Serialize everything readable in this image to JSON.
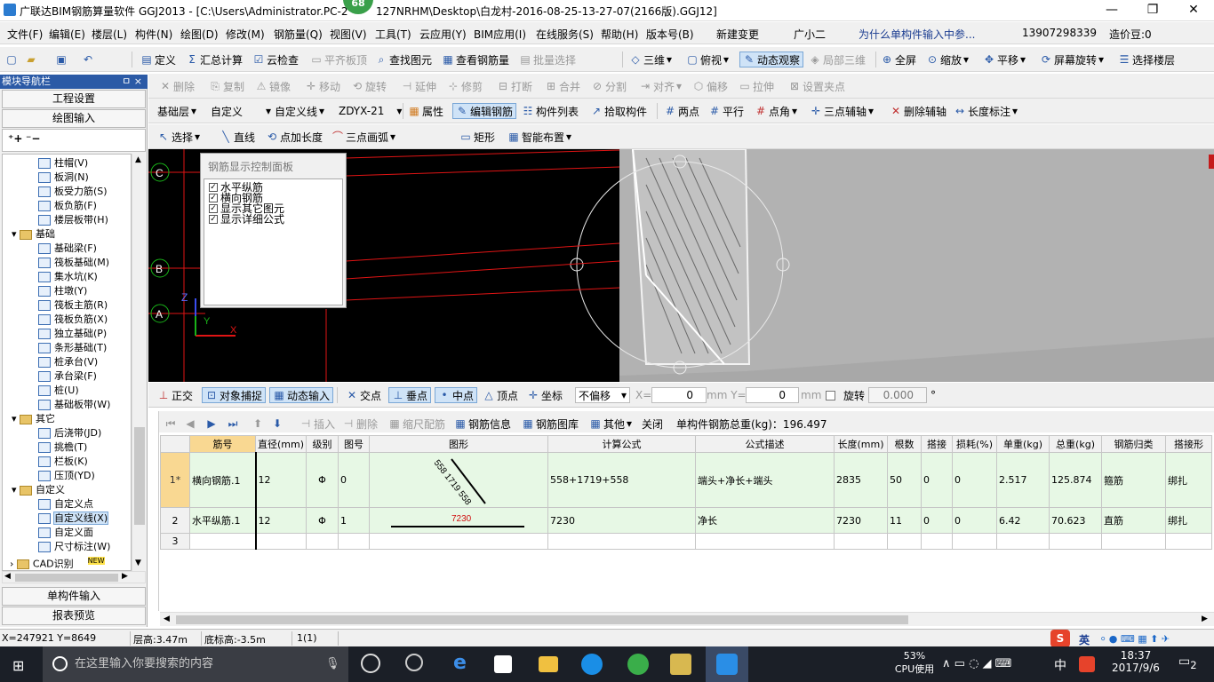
{
  "window": {
    "title": "广联达BIM钢筋算量软件 GGJ2013 - [C:\\Users\\Administrator.PC-2",
    "title_tail": "127NRHM\\Desktop\\白龙村-2016-08-25-13-27-07(2166版).GGJ12]",
    "badge": "68"
  },
  "menu": [
    "文件(F)",
    "编辑(E)",
    "楼层(L)",
    "构件(N)",
    "绘图(D)",
    "修改(M)",
    "钢筋量(Q)",
    "视图(V)",
    "工具(T)",
    "云应用(Y)",
    "BIM应用(I)",
    "在线服务(S)",
    "帮助(H)",
    "版本号(B)",
    "新建变更",
    "广小二",
    "为什么单构件输入中参...",
    "13907298339",
    "造价豆:0"
  ],
  "toolbar1": [
    "定义",
    "汇总计算",
    "云检查",
    "平齐板顶",
    "查找图元",
    "查看钢筋量",
    "批量选择",
    "三维",
    "俯视",
    "动态观察",
    "局部三维",
    "全屏",
    "缩放",
    "平移",
    "屏幕旋转",
    "选择楼层"
  ],
  "toolbar2": [
    "删除",
    "复制",
    "镜像",
    "移动",
    "旋转",
    "延伸",
    "修剪",
    "打断",
    "合并",
    "分割",
    "对齐",
    "偏移",
    "拉伸",
    "设置夹点"
  ],
  "toolbar3": {
    "floor": "基础层",
    "type": "自定义",
    "subtype": "自定义线",
    "name": "ZDYX-21",
    "items": [
      "属性",
      "编辑钢筋",
      "构件列表",
      "拾取构件",
      "两点",
      "平行",
      "点角",
      "三点辅轴",
      "删除辅轴",
      "长度标注"
    ]
  },
  "toolbar4": [
    "选择",
    "直线",
    "点加长度",
    "三点画弧",
    "矩形",
    "智能布置"
  ],
  "leftpanel": {
    "header": "模块导航栏",
    "pin": "ㅁ ×",
    "btn_project": "工程设置",
    "btn_draw": "绘图输入",
    "btn_single": "单构件输入",
    "btn_report": "报表预览",
    "tree": [
      {
        "label": "柱帽(V)",
        "level": 2
      },
      {
        "label": "板洞(N)",
        "level": 2
      },
      {
        "label": "板受力筋(S)",
        "level": 2
      },
      {
        "label": "板负筋(F)",
        "level": 2
      },
      {
        "label": "楼层板带(H)",
        "level": 2
      },
      {
        "label": "基础",
        "level": 1
      },
      {
        "label": "基础梁(F)",
        "level": 2
      },
      {
        "label": "筏板基础(M)",
        "level": 2
      },
      {
        "label": "集水坑(K)",
        "level": 2
      },
      {
        "label": "柱墩(Y)",
        "level": 2
      },
      {
        "label": "筏板主筋(R)",
        "level": 2
      },
      {
        "label": "筏板负筋(X)",
        "level": 2
      },
      {
        "label": "独立基础(P)",
        "level": 2
      },
      {
        "label": "条形基础(T)",
        "level": 2
      },
      {
        "label": "桩承台(V)",
        "level": 2
      },
      {
        "label": "承台梁(F)",
        "level": 2
      },
      {
        "label": "桩(U)",
        "level": 2
      },
      {
        "label": "基础板带(W)",
        "level": 2
      },
      {
        "label": "其它",
        "level": 1
      },
      {
        "label": "后浇带(JD)",
        "level": 2
      },
      {
        "label": "挑檐(T)",
        "level": 2
      },
      {
        "label": "栏板(K)",
        "level": 2
      },
      {
        "label": "压顶(YD)",
        "level": 2
      },
      {
        "label": "自定义",
        "level": 1
      },
      {
        "label": "自定义点",
        "level": 2
      },
      {
        "label": "自定义线(X)",
        "level": 2
      },
      {
        "label": "自定义面",
        "level": 2
      },
      {
        "label": "尺寸标注(W)",
        "level": 2
      },
      {
        "label": "CAD识别",
        "level": 0,
        "new": "NEW"
      }
    ]
  },
  "canvas": {
    "axes": [
      "C",
      "B",
      "A"
    ],
    "axis_z": "Z",
    "axis_y": "Y",
    "axis_x": "X"
  },
  "rebar_panel": {
    "title": "钢筋显示控制面板",
    "options": [
      {
        "label": "水平纵筋",
        "checked": true
      },
      {
        "label": "横向钢筋",
        "checked": true
      },
      {
        "label": "显示其它图元",
        "checked": true
      },
      {
        "label": "显示详细公式",
        "checked": true
      }
    ]
  },
  "snapbar": {
    "items": [
      "正交",
      "对象捕捉",
      "动态输入",
      "交点",
      "垂点",
      "中点",
      "顶点",
      "坐标"
    ],
    "offset": "不偏移",
    "x_label": "X=",
    "x_value": "0",
    "y_label": "mm Y=",
    "y_value": "0",
    "mm": "mm",
    "rotate_label": "旋转",
    "rotate_value": "0.000",
    "degree": "°"
  },
  "gridtoolbar": {
    "items": [
      "插入",
      "删除",
      "缩尺配筋",
      "钢筋信息",
      "钢筋图库",
      "其他",
      "关闭"
    ],
    "total": "单构件钢筋总重(kg)：196.497"
  },
  "table": {
    "headers": [
      "筋号",
      "直径(mm)",
      "级别",
      "图号",
      "图形",
      "计算公式",
      "公式描述",
      "长度(mm)",
      "根数",
      "搭接",
      "损耗(%)",
      "单重(kg)",
      "总重(kg)",
      "钢筋归类",
      "搭接形"
    ],
    "rows": [
      {
        "idx": "1*",
        "cells": [
          "横向钢筋.1",
          "12",
          "Φ",
          "0",
          "",
          "558+1719+558",
          "端头+净长+端头",
          "2835",
          "50",
          "0",
          "0",
          "2.517",
          "125.874",
          "箍筋",
          "绑扎"
        ],
        "shape": "558 1719 558"
      },
      {
        "idx": "2",
        "cells": [
          "水平纵筋.1",
          "12",
          "Φ",
          "1",
          "",
          "7230",
          "净长",
          "7230",
          "11",
          "0",
          "0",
          "6.42",
          "70.623",
          "直筋",
          "绑扎"
        ],
        "shape": "7230"
      },
      {
        "idx": "3",
        "cells": [
          "",
          "",
          "",
          "",
          "",
          "",
          "",
          "",
          "",
          "",
          "",
          "",
          "",
          "",
          ""
        ]
      }
    ]
  },
  "status": {
    "coords": "X=247921 Y=8649",
    "floor_height": "层高:3.47m",
    "base_height": "底标高:-3.5m",
    "count": "1(1)"
  },
  "taskbar": {
    "search_placeholder": "在这里输入你要搜索的内容",
    "cpu_percent": "53%",
    "cpu_label": "CPU使用",
    "ime": "中",
    "time": "18:37",
    "date": "2017/9/6",
    "notif": "2",
    "ime_tray": "英"
  }
}
